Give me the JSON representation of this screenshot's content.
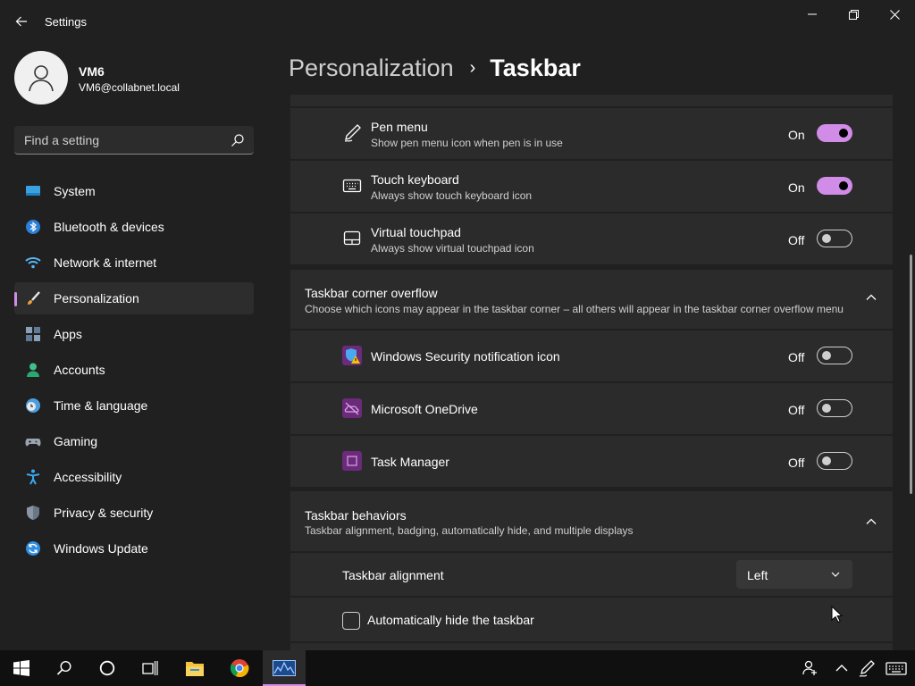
{
  "window": {
    "title": "Settings",
    "icons": {
      "back": "back-arrow-icon",
      "minimize": "minimize-icon",
      "maximize": "restore-icon",
      "close": "close-icon"
    }
  },
  "profile": {
    "name": "VM6",
    "email": "VM6@collabnet.local"
  },
  "search": {
    "placeholder": "Find a setting",
    "value": ""
  },
  "sidebar": {
    "items": [
      {
        "label": "System",
        "icon": "system-icon",
        "active": false
      },
      {
        "label": "Bluetooth & devices",
        "icon": "bluetooth-icon",
        "active": false
      },
      {
        "label": "Network & internet",
        "icon": "wifi-icon",
        "active": false
      },
      {
        "label": "Personalization",
        "icon": "brush-icon",
        "active": true
      },
      {
        "label": "Apps",
        "icon": "apps-icon",
        "active": false
      },
      {
        "label": "Accounts",
        "icon": "account-icon",
        "active": false
      },
      {
        "label": "Time & language",
        "icon": "clock-globe-icon",
        "active": false
      },
      {
        "label": "Gaming",
        "icon": "gamepad-icon",
        "active": false
      },
      {
        "label": "Accessibility",
        "icon": "accessibility-icon",
        "active": false
      },
      {
        "label": "Privacy & security",
        "icon": "shield-icon",
        "active": false
      },
      {
        "label": "Windows Update",
        "icon": "update-icon",
        "active": false
      }
    ]
  },
  "breadcrumb": {
    "parent": "Personalization",
    "separator": "›",
    "current": "Taskbar"
  },
  "pen_menu": {
    "label": "Pen menu",
    "description": "Show pen menu icon when pen is in use",
    "state": "On"
  },
  "touch_keyboard": {
    "label": "Touch keyboard",
    "description": "Always show touch keyboard icon",
    "state": "On"
  },
  "virtual_touchpad": {
    "label": "Virtual touchpad",
    "description": "Always show virtual touchpad icon",
    "state": "Off"
  },
  "corner_overflow": {
    "title": "Taskbar corner overflow",
    "description": "Choose which icons may appear in the taskbar corner – all others will appear in the taskbar corner overflow menu",
    "items": [
      {
        "label": "Windows Security notification icon",
        "state": "Off",
        "icon": "windows-security-icon"
      },
      {
        "label": "Microsoft OneDrive",
        "state": "Off",
        "icon": "onedrive-icon"
      },
      {
        "label": "Task Manager",
        "state": "Off",
        "icon": "task-manager-icon"
      }
    ]
  },
  "behaviors": {
    "title": "Taskbar behaviors",
    "description": "Taskbar alignment, badging, automatically hide, and multiple displays",
    "alignment_label": "Taskbar alignment",
    "alignment_value": "Left",
    "autohide_label": "Automatically hide the taskbar",
    "autohide_checked": false
  },
  "taskbar": {
    "apps": [
      "windows-start-icon",
      "search-icon",
      "cortana-circle-icon",
      "task-view-icon",
      "file-explorer-icon",
      "chrome-icon",
      "settings-app-icon"
    ],
    "tray": [
      "people-icon",
      "chevron-up-icon",
      "pen-icon",
      "keyboard-icon"
    ]
  },
  "colors": {
    "accent": "#d18ce8",
    "background": "#202020",
    "card": "#2b2b2b",
    "taskbar": "#101010"
  }
}
